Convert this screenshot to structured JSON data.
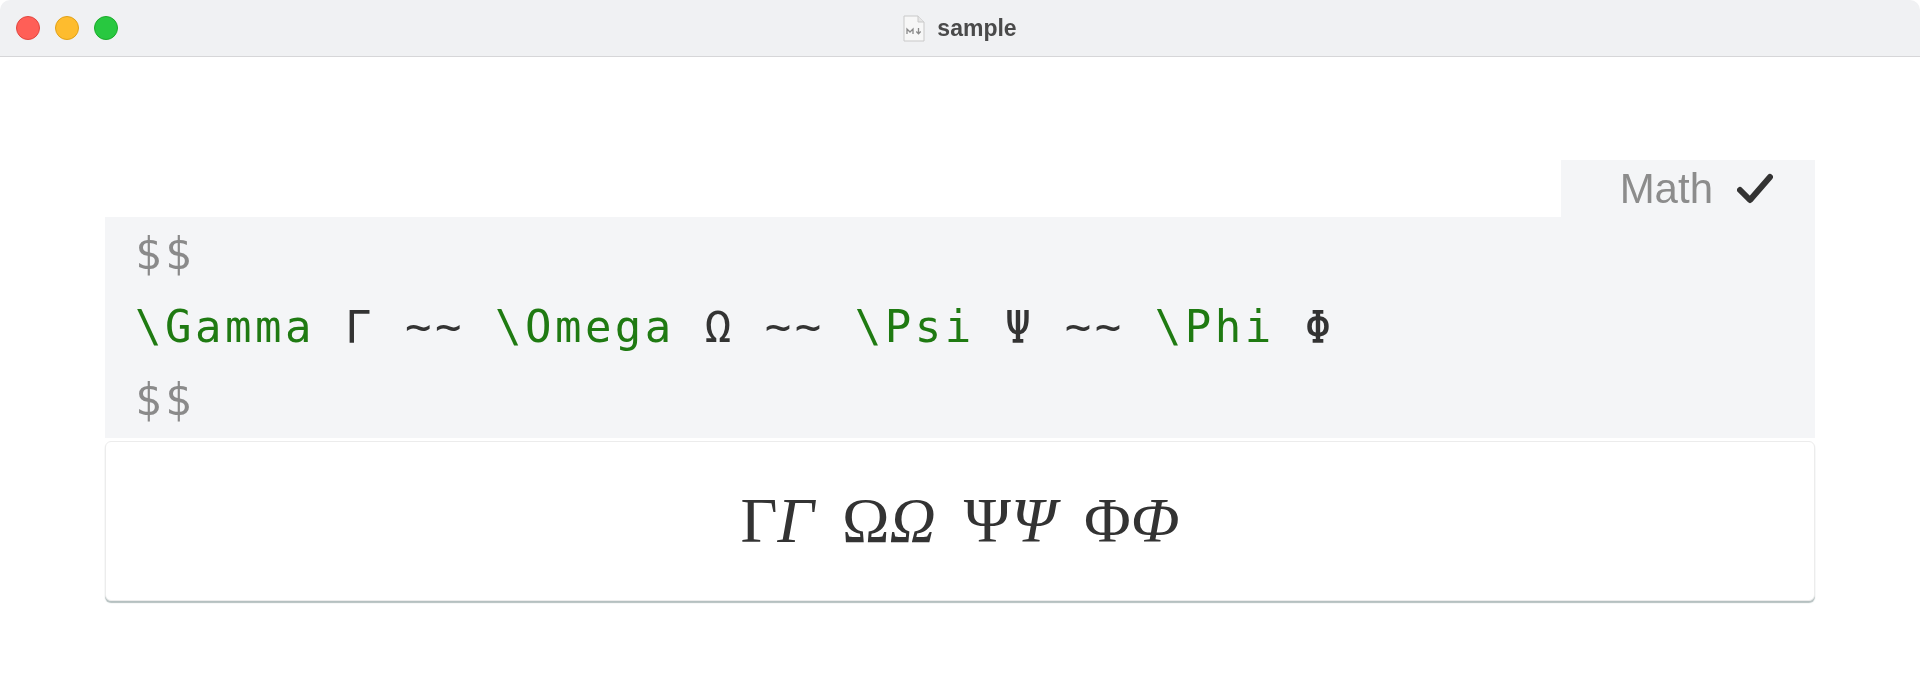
{
  "window": {
    "title": "sample"
  },
  "math_block": {
    "label": "Math",
    "source_lines": [
      {
        "tokens": [
          {
            "kind": "delimiter",
            "text": "$$"
          }
        ]
      },
      {
        "tokens": [
          {
            "kind": "command",
            "text": "\\Gamma"
          },
          {
            "kind": "text",
            "text": " Γ ~~ "
          },
          {
            "kind": "command",
            "text": "\\Omega"
          },
          {
            "kind": "text",
            "text": " Ω ~~ "
          },
          {
            "kind": "command",
            "text": "\\Psi"
          },
          {
            "kind": "text",
            "text": " Ψ ~~ "
          },
          {
            "kind": "command",
            "text": "\\Phi"
          },
          {
            "kind": "text",
            "text": " Φ"
          }
        ]
      },
      {
        "tokens": [
          {
            "kind": "delimiter",
            "text": "$$"
          }
        ]
      }
    ],
    "rendered": [
      {
        "upright": "Γ",
        "italic": "Γ"
      },
      {
        "upright": "Ω",
        "italic": "Ω"
      },
      {
        "upright": "Ψ",
        "italic": "Ψ"
      },
      {
        "upright": "Φ",
        "italic": "Φ"
      }
    ]
  }
}
